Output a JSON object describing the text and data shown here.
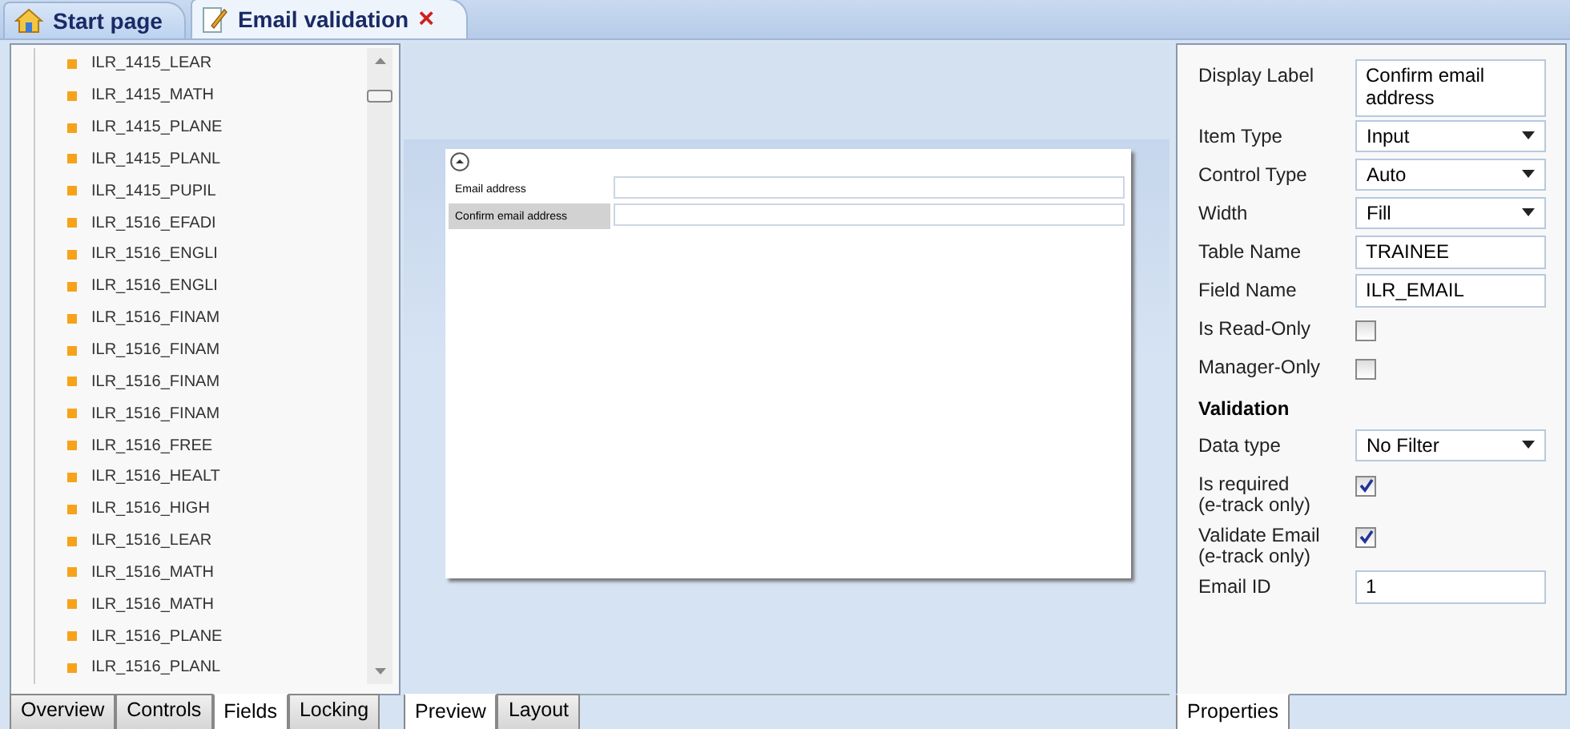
{
  "doc_tabs": [
    {
      "label": "Start page",
      "selected": false
    },
    {
      "label": "Email validation",
      "selected": true
    }
  ],
  "close_glyph": "×",
  "fields": [
    "ILR_1415_LEAR",
    "ILR_1415_MATH",
    "ILR_1415_PLANE",
    "ILR_1415_PLANL",
    "ILR_1415_PUPIL",
    "ILR_1516_EFADI",
    "ILR_1516_ENGLI",
    "ILR_1516_ENGLI",
    "ILR_1516_FINAM",
    "ILR_1516_FINAM",
    "ILR_1516_FINAM",
    "ILR_1516_FINAM",
    "ILR_1516_FREE",
    "ILR_1516_HEALT",
    "ILR_1516_HIGH",
    "ILR_1516_LEAR",
    "ILR_1516_MATH",
    "ILR_1516_MATH",
    "ILR_1516_PLANE",
    "ILR_1516_PLANL"
  ],
  "left_tabs": [
    {
      "label": "Overview",
      "selected": false
    },
    {
      "label": "Controls",
      "selected": false
    },
    {
      "label": "Fields",
      "selected": true
    },
    {
      "label": "Locking",
      "selected": false
    }
  ],
  "preview": {
    "rows": [
      {
        "label": "Email address",
        "selected": false
      },
      {
        "label": "Confirm email address",
        "selected": true
      }
    ]
  },
  "center_tabs": [
    {
      "label": "Preview",
      "selected": true
    },
    {
      "label": "Layout",
      "selected": false
    }
  ],
  "properties": [
    {
      "kind": "text",
      "label": "Display Label",
      "value": "Confirm email address"
    },
    {
      "kind": "select",
      "label": "Item Type",
      "value": "Input"
    },
    {
      "kind": "select",
      "label": "Control Type",
      "value": "Auto"
    },
    {
      "kind": "select",
      "label": "Width",
      "value": "Fill"
    },
    {
      "kind": "text",
      "label": "Table Name",
      "value": "TRAINEE"
    },
    {
      "kind": "text",
      "label": "Field Name",
      "value": "ILR_EMAIL"
    },
    {
      "kind": "checkbox",
      "label": "Is Read-Only",
      "checked": false
    },
    {
      "kind": "checkbox",
      "label": "Manager-Only",
      "checked": false
    },
    {
      "kind": "heading",
      "label": "Validation"
    },
    {
      "kind": "select",
      "label": "Data type",
      "value": "No Filter"
    },
    {
      "kind": "checkbox",
      "label": "Is required\n(e-track only)",
      "checked": true
    },
    {
      "kind": "checkbox",
      "label": "Validate Email\n(e-track only)",
      "checked": true
    },
    {
      "kind": "text",
      "label": "Email ID",
      "value": "1"
    }
  ],
  "right_tabs": [
    {
      "label": "Properties",
      "selected": true
    }
  ]
}
